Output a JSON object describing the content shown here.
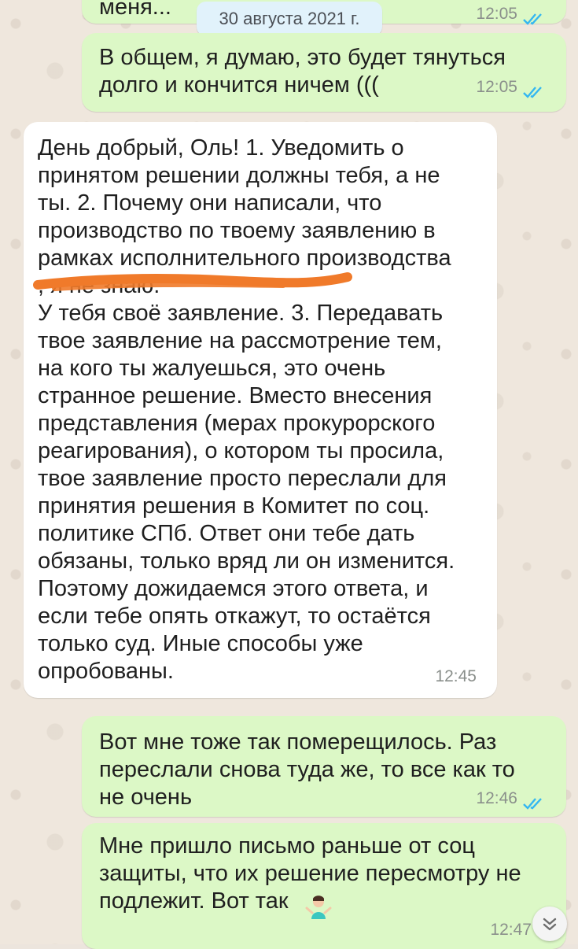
{
  "chat": {
    "date_separator": "30 августа 2021 г.",
    "messages": [
      {
        "direction": "out",
        "text": "меня...",
        "time": "12:05",
        "status": "read"
      },
      {
        "direction": "out",
        "text": "В общем, я думаю, это будет тянуться\nдолго и кончится ничем (((",
        "time": "12:05",
        "status": "read"
      },
      {
        "direction": "in",
        "text": "День добрый, Оль! 1. Уведомить о\nпринятом решении должны тебя, а не\nты. 2. Почему они написали, что\nпроизводство по твоему заявлению в\nрамках исполнительного производства\n                                       , я не знаю.\nУ тебя своё заявление. 3. Передавать\nтвое заявление на рассмотрение тем,\nна кого ты жалуешься, это очень\nстранное решение. Вместо внесения\nпредставления (мерах прокурорского\nреагирования), о котором ты просила,\nтвое заявление просто переслали для\nпринятия решения в Комитет по соц.\nполитике СПб. Ответ они тебе дать\nобязаны, только вряд ли он изменится.\nПоэтому дожидаемся этого ответа, и\nесли тебе опять откажут, то остаётся\nтолько суд. Иные способы уже\nопробованы.",
        "time": "12:45"
      },
      {
        "direction": "out",
        "text": "Вот мне тоже так померещилось. Раз\nпереслали снова туда же, то все как то\nне очень",
        "time": "12:46",
        "status": "read"
      },
      {
        "direction": "out",
        "text": "Мне пришло письмо раньше от соц\nзащиты, что их решение пересмотру не\nподлежит. Вот так",
        "emoji": "person-shrugging",
        "time": "12:47"
      }
    ],
    "redaction_color": "#f07a2a",
    "accent_read_ticks": "#34b7f1",
    "bubble_out_color": "#dcf8c6",
    "bubble_in_color": "#ffffff"
  }
}
